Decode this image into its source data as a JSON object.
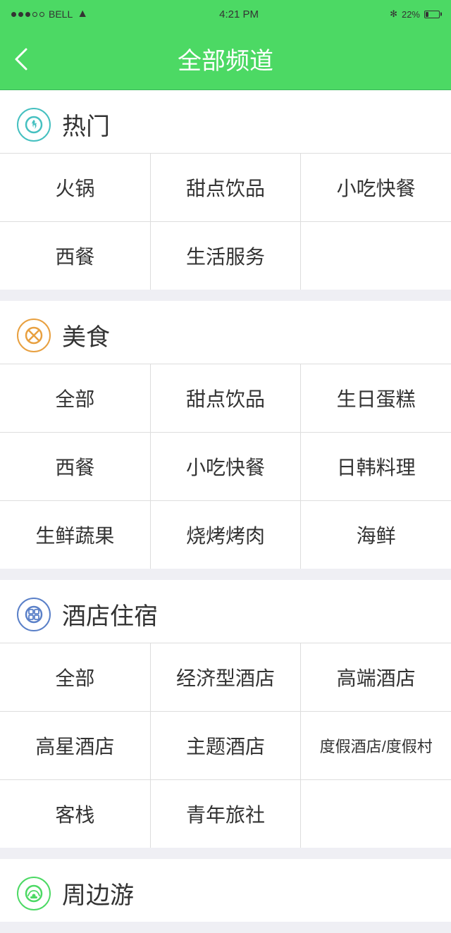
{
  "statusBar": {
    "carrier": "BELL",
    "time": "4:21 PM",
    "battery": "22%"
  },
  "navBar": {
    "title": "全部频道",
    "backLabel": "<"
  },
  "sections": [
    {
      "id": "hot",
      "iconType": "hot",
      "iconSymbol": "🔥",
      "title": "热门",
      "items": [
        [
          "火锅",
          "甜点饮品",
          "小吃快餐"
        ],
        [
          "西餐",
          "生活服务",
          ""
        ]
      ]
    },
    {
      "id": "food",
      "iconType": "food",
      "iconSymbol": "✕",
      "title": "美食",
      "items": [
        [
          "全部",
          "甜点饮品",
          "生日蛋糕"
        ],
        [
          "西餐",
          "小吃快餐",
          "日韩料理"
        ],
        [
          "生鲜蔬果",
          "烧烤烤肉",
          "海鲜"
        ]
      ]
    },
    {
      "id": "hotel",
      "iconType": "hotel",
      "iconSymbol": "⊞",
      "title": "酒店住宿",
      "items": [
        [
          "全部",
          "经济型酒店",
          "高端酒店"
        ],
        [
          "高星酒店",
          "主题酒店",
          "度假酒店/度假村"
        ],
        [
          "客栈",
          "青年旅社",
          ""
        ]
      ]
    },
    {
      "id": "travel",
      "iconType": "travel",
      "iconSymbol": "🚗",
      "title": "周边游",
      "items": []
    }
  ]
}
